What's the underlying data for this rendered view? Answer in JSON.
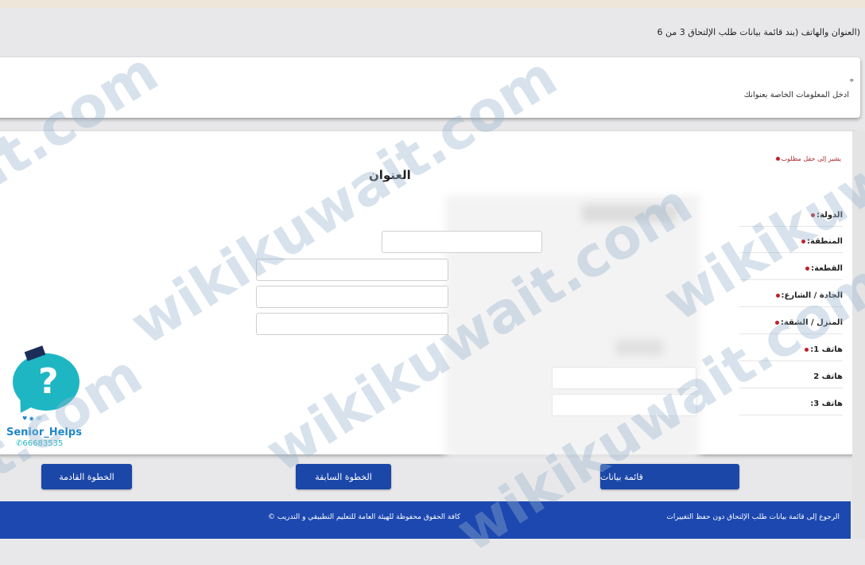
{
  "step_title": "(العنوان والهاتف (بند قائمة بيانات طلب الإلتحاق 3 من 6",
  "info": {
    "icon": "pin-icon",
    "text": "ادخل المعلومات الخاصة بعنوانك"
  },
  "form": {
    "required_note": "يشير إلى حقل مطلوب",
    "section_title": "العنوان",
    "labels": {
      "country": "الدولة:",
      "region": "المنطقة:",
      "block": "القطعة:",
      "street": "الجادة / الشارع:",
      "house": "المنزل / الشقة:",
      "phone1": "هاتف 1:",
      "phone2": "هاتف 2",
      "phone3": "هاتف 3:"
    }
  },
  "buttons": {
    "next": "الخطوة القادمة",
    "prev": "الخطوة السابقة",
    "list": "قائمة بيانات"
  },
  "footer": {
    "back_link": "الرجوع إلى قائمة بيانات طلب الإلتحاق دون حفظ التغييرات",
    "copyright": "كافة الحقوق محفوظة للهيئة العامة للتعليم التطبيقي و التدريب ©"
  },
  "watermark": {
    "text_a": "wikikuwait.com",
    "text_b": "it.com"
  },
  "logo": {
    "handle": "Senior_Helps",
    "phone": "66683535"
  },
  "colors": {
    "primary": "#1b47a8",
    "required": "#c0202a",
    "logo_teal": "#1fb6c4"
  }
}
